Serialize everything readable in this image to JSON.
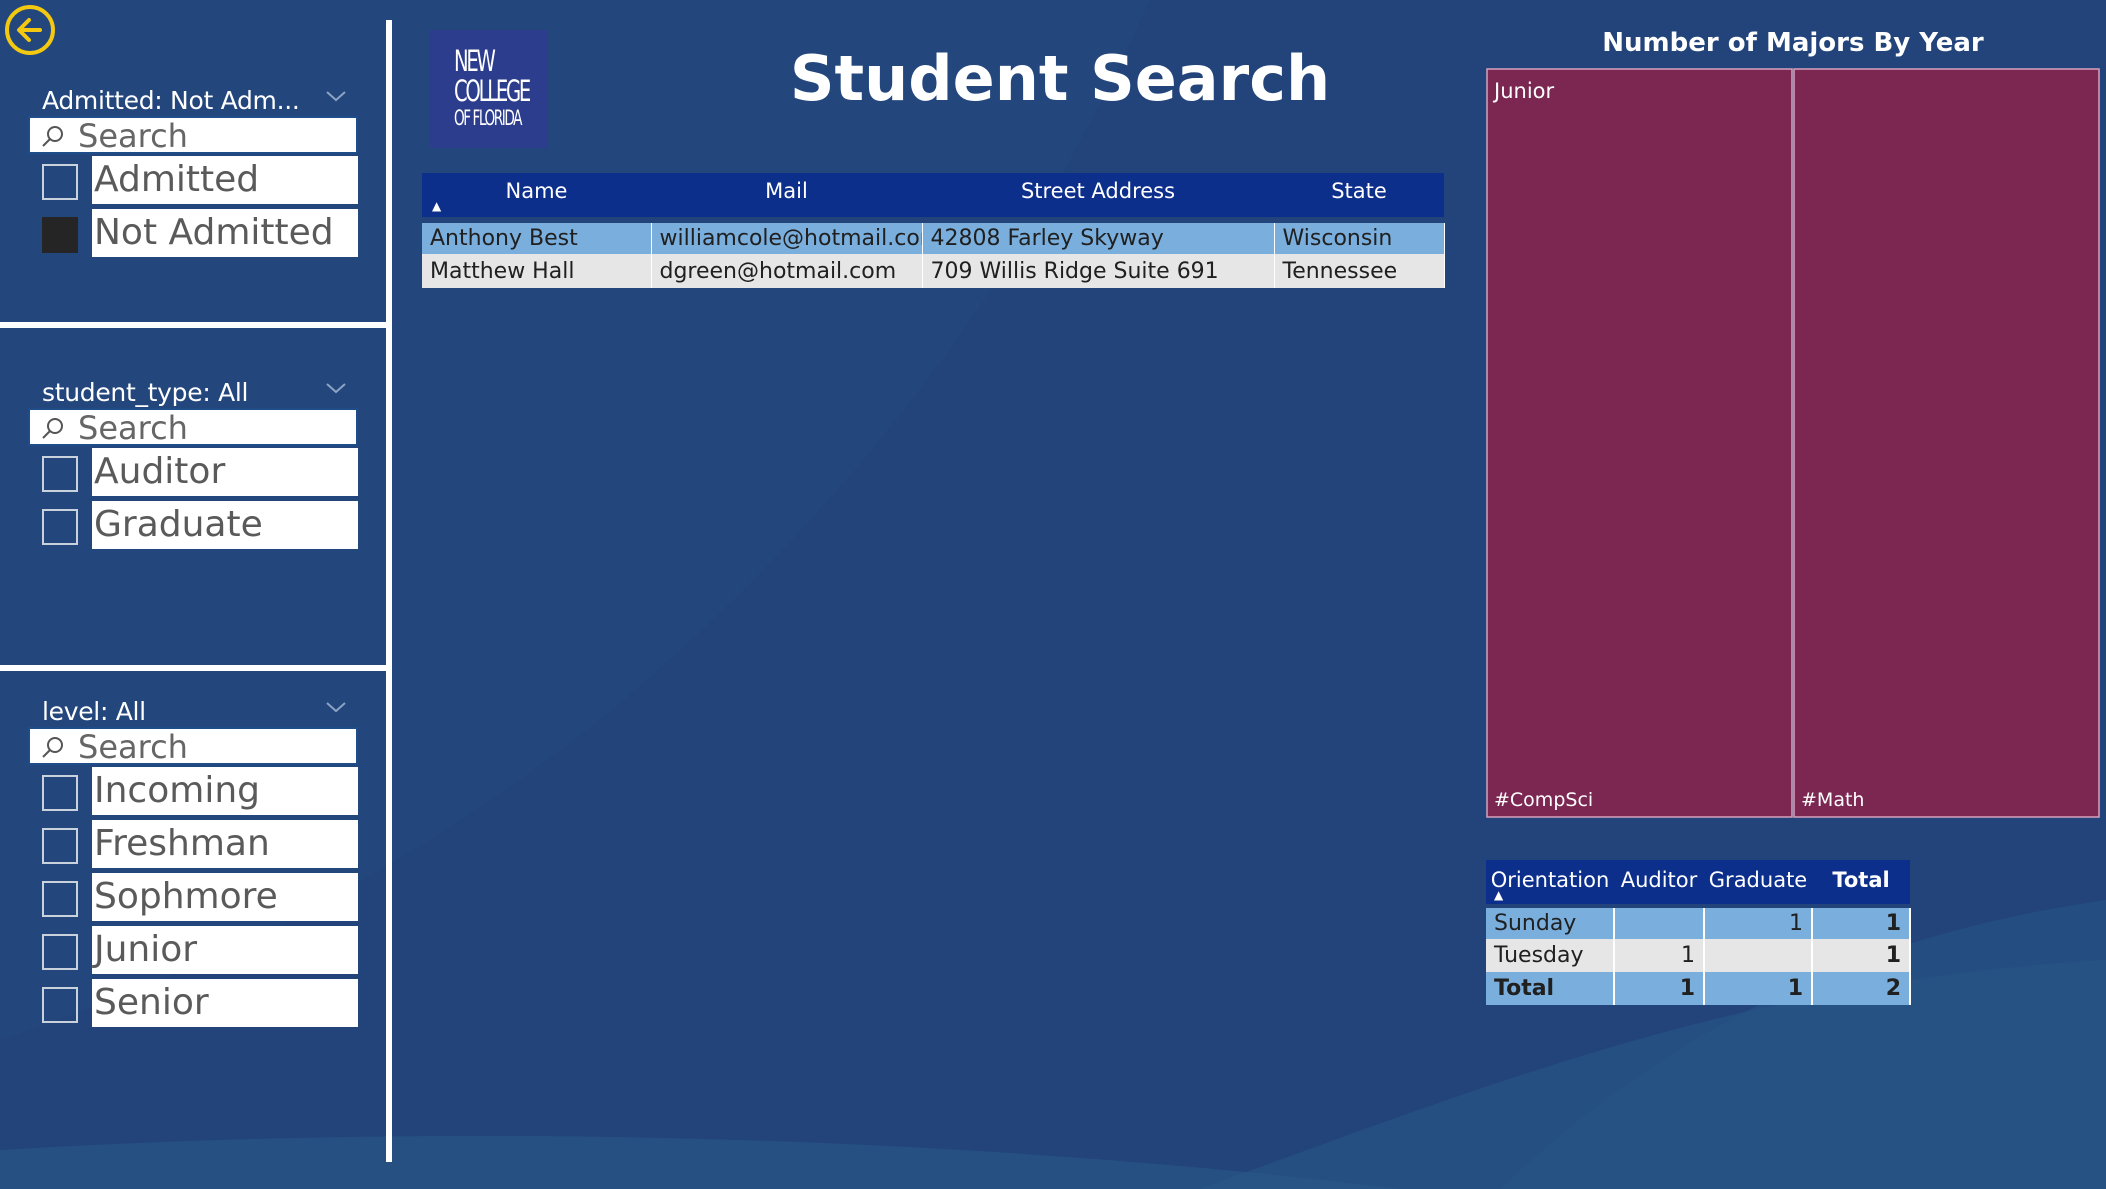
{
  "colors": {
    "page_background": "#22447a",
    "header_blue": "#0d2f8c",
    "row_highlight": "#79aedd",
    "row_plain": "#e6e6e6",
    "treemap_fill": "#7b2752",
    "back_button_yellow": "#f2c811",
    "logo_background": "#2c3d8d"
  },
  "navigation": {
    "back_icon": "back-arrow-circle-icon"
  },
  "slicers": [
    {
      "title": "Admitted: Not Adm...",
      "search_placeholder": "Search",
      "options": [
        {
          "label": "Admitted",
          "checked": false
        },
        {
          "label": "Not Admitted",
          "checked": true
        }
      ]
    },
    {
      "title": "student_type: All",
      "search_placeholder": "Search",
      "options": [
        {
          "label": "Auditor",
          "checked": false
        },
        {
          "label": "Graduate",
          "checked": false
        }
      ]
    },
    {
      "title": "level: All",
      "search_placeholder": "Search",
      "options": [
        {
          "label": "Incoming",
          "checked": false
        },
        {
          "label": "Freshman",
          "checked": false
        },
        {
          "label": "Sophmore",
          "checked": false
        },
        {
          "label": "Junior",
          "checked": false
        },
        {
          "label": "Senior",
          "checked": false
        }
      ]
    }
  ],
  "logo": {
    "lines": [
      "NEW",
      "COLLEGE",
      "OF FLORIDA"
    ]
  },
  "header": {
    "title": "Student Search"
  },
  "student_table": {
    "columns": [
      "Name",
      "Mail",
      "Street Address",
      "State"
    ],
    "sort_icon": "sort-ascending-icon",
    "rows": [
      [
        "Anthony Best",
        "williamcole@hotmail.com",
        "42808 Farley Skyway",
        "Wisconsin"
      ],
      [
        "Matthew Hall",
        "dgreen@hotmail.com",
        "709 Willis Ridge Suite 691",
        "Tennessee"
      ]
    ]
  },
  "treemap": {
    "title": "Number of Majors By Year",
    "group_label": "Junior",
    "tiles": [
      {
        "label": "#CompSci",
        "value": 1
      },
      {
        "label": "#Math",
        "value": 1
      }
    ]
  },
  "matrix": {
    "columns": [
      "Orientation",
      "Auditor",
      "Graduate",
      "Total"
    ],
    "rows": [
      [
        "Sunday",
        "",
        "1",
        "1"
      ],
      [
        "Tuesday",
        "1",
        "",
        "1"
      ]
    ],
    "total_row": [
      "Total",
      "1",
      "1",
      "2"
    ]
  }
}
